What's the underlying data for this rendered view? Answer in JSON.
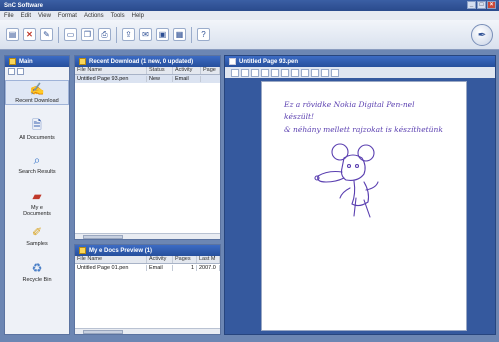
{
  "window": {
    "title": "SnC Software"
  },
  "menu": [
    "File",
    "Edit",
    "View",
    "Format",
    "Actions",
    "Tools",
    "Help"
  ],
  "toolbar": {
    "icons": [
      "save-icon",
      "delete-icon",
      "pen-icon",
      "document-icon",
      "copy-icon",
      "print-icon",
      "export-icon",
      "mail-icon",
      "folder-icon",
      "help-icon"
    ]
  },
  "sidebar": {
    "title": "Main",
    "items": [
      {
        "label": "Recent Download",
        "icon": "pen-icon"
      },
      {
        "label": "All Documents",
        "icon": "documents-icon"
      },
      {
        "label": "Search Results",
        "icon": "search-icon"
      },
      {
        "label": "My e Documents",
        "icon": "folder-icon"
      },
      {
        "label": "Samples",
        "icon": "samples-icon"
      },
      {
        "label": "Recycle Bin",
        "icon": "recycle-bin-icon"
      }
    ]
  },
  "recent": {
    "title": "Recent Download (1 new, 0 updated)",
    "columns": [
      "File Name",
      "Status",
      "Activity",
      "Page"
    ],
    "rows": [
      {
        "name": "Untitled Page 93.pen",
        "status": "New",
        "activity": "Email",
        "page": ""
      }
    ]
  },
  "preview": {
    "title": "My e Docs Preview (1)",
    "columns": [
      "File Name",
      "Activity",
      "Pages",
      "Last M"
    ],
    "rows": [
      {
        "name": "Untitled Page 01.pen",
        "activity": "Email",
        "pages": "1",
        "last": "2007.0"
      }
    ]
  },
  "viewer": {
    "title": "Untitled Page 93.pen",
    "ink_lines": [
      "Ez a rövidke Nokia Digital Pen-nel",
      "készült!",
      "& néhány mellett rajzokat is készíthetünk"
    ]
  }
}
